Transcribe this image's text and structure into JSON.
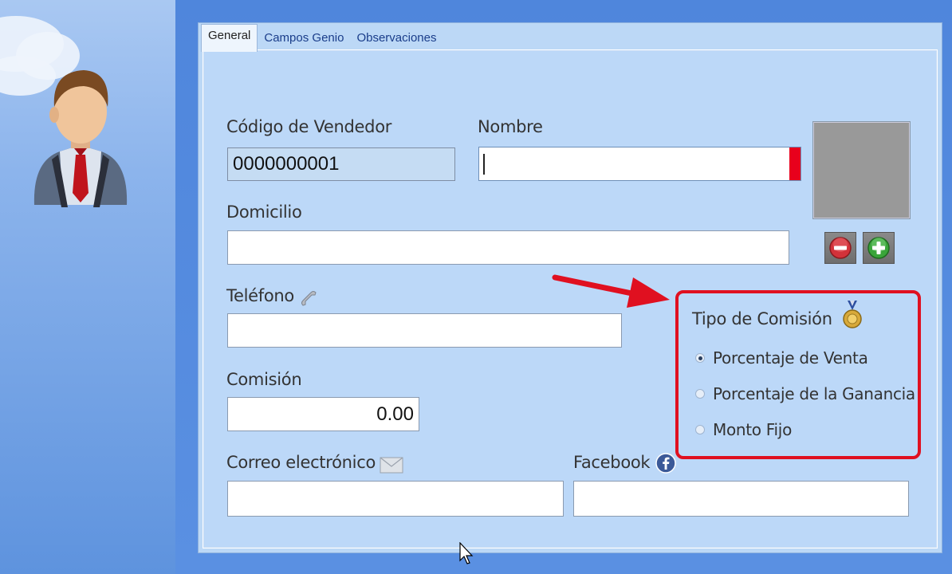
{
  "tabs": [
    {
      "label": "General",
      "active": true
    },
    {
      "label": "Campos Genio",
      "active": false
    },
    {
      "label": "Observaciones",
      "active": false
    }
  ],
  "form": {
    "codigo_label": "Código de Vendedor",
    "codigo_value": "0000000001",
    "nombre_label": "Nombre",
    "nombre_value": "",
    "domicilio_label": "Domicilio",
    "domicilio_value": "",
    "telefono_label": "Teléfono",
    "telefono_value": "",
    "comision_label": "Comisión",
    "comision_value": "0.00",
    "correo_label": "Correo electrónico",
    "correo_value": "",
    "facebook_label": "Facebook",
    "facebook_value": ""
  },
  "comision_tipo": {
    "title": "Tipo de Comisión",
    "options": [
      {
        "label": "Porcentaje de Venta",
        "selected": true
      },
      {
        "label": "Porcentaje de la Ganancia",
        "selected": false
      },
      {
        "label": "Monto Fijo",
        "selected": false
      }
    ]
  },
  "colors": {
    "required_marker": "#e8001c",
    "highlight": "#e01020",
    "arrow": "#e01020"
  },
  "icons": {
    "remove": "minus-icon",
    "add": "plus-icon",
    "phone": "phone-icon",
    "medal": "medal-icon",
    "mail": "envelope-icon",
    "facebook": "facebook-icon"
  }
}
